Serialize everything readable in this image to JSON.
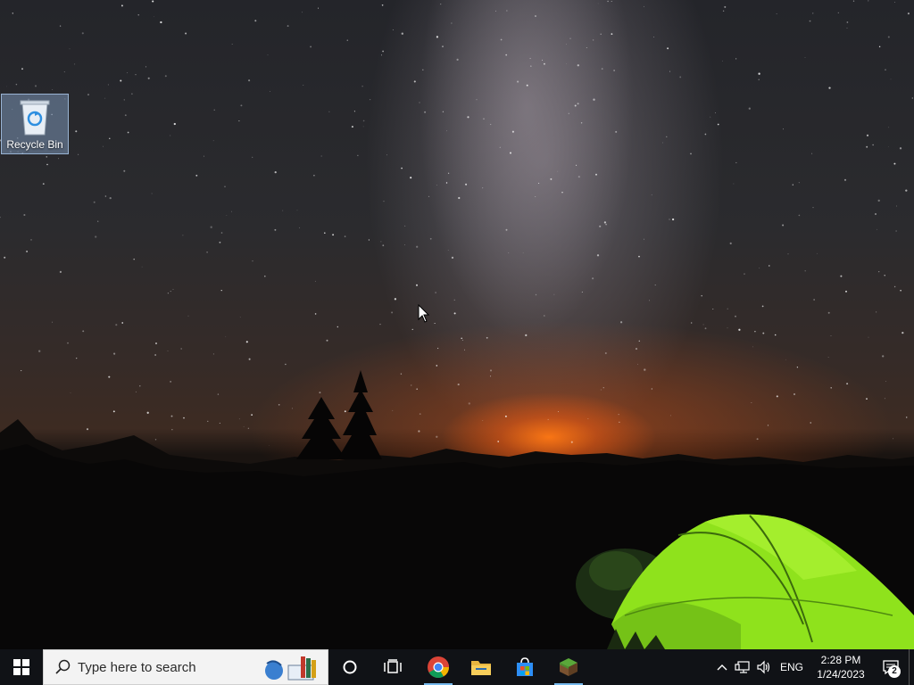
{
  "desktop": {
    "icons": [
      {
        "label": "Recycle Bin",
        "icon": "recycle-bin-icon"
      }
    ]
  },
  "taskbar": {
    "start_icon": "windows-logo-icon",
    "search": {
      "placeholder": "Type here to search",
      "icon": "search-icon"
    },
    "cortana_icon": "cortana-circle-icon",
    "task_view_icon": "task-view-icon",
    "apps": [
      {
        "name": "Google Chrome",
        "icon": "chrome-icon",
        "active": true
      },
      {
        "name": "File Explorer",
        "icon": "folder-icon",
        "active": false
      },
      {
        "name": "Microsoft Store",
        "icon": "store-icon",
        "active": false
      },
      {
        "name": "Minecraft",
        "icon": "minecraft-icon",
        "active": true
      }
    ],
    "tray": {
      "language": "ENG",
      "time": "2:28 PM",
      "date": "1/24/2023",
      "notification_count": "2"
    }
  },
  "colors": {
    "taskbar_bg": "#101216",
    "active_indicator": "#76b9ed",
    "tent_green": "#8fe21c"
  }
}
